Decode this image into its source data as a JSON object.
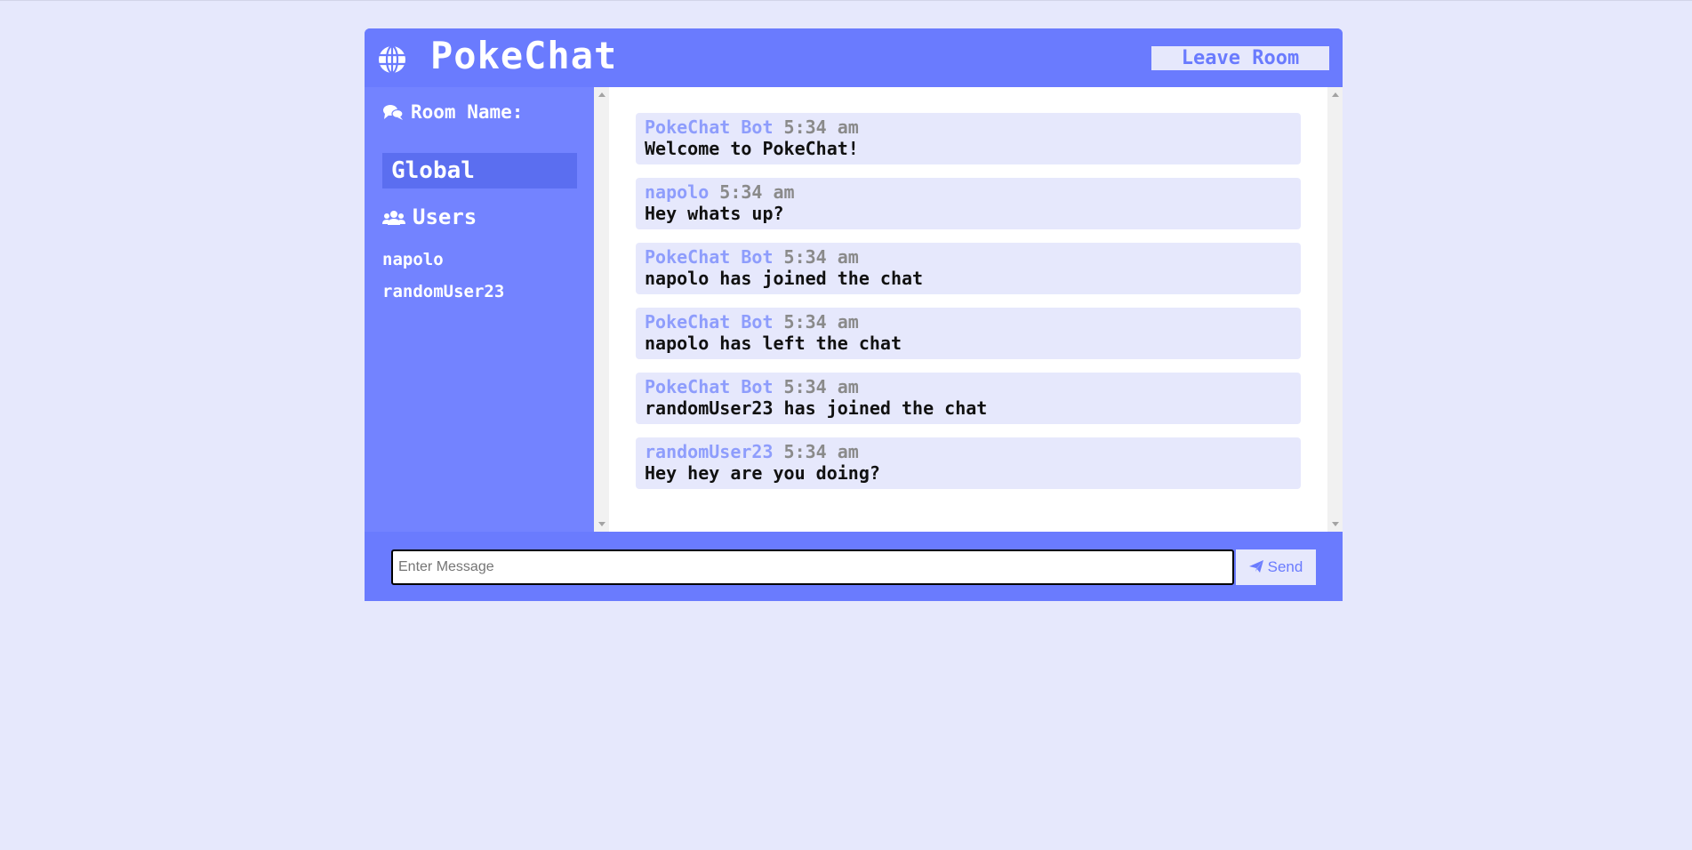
{
  "header": {
    "title": "PokeChat",
    "leave_label": "Leave Room",
    "logo_icon": "globe-icon"
  },
  "sidebar": {
    "room_heading": "Room Name:",
    "room_icon": "comments-icon",
    "room_name": "Global",
    "users_heading": "Users",
    "users_icon": "users-icon",
    "users": [
      "napolo",
      "randomUser23"
    ]
  },
  "messages": [
    {
      "user": "PokeChat Bot",
      "time": "5:34 am",
      "text": "Welcome to PokeChat!"
    },
    {
      "user": "napolo",
      "time": "5:34 am",
      "text": "Hey whats up?"
    },
    {
      "user": "PokeChat Bot",
      "time": "5:34 am",
      "text": "napolo has joined the chat"
    },
    {
      "user": "PokeChat Bot",
      "time": "5:34 am",
      "text": "napolo has left the chat"
    },
    {
      "user": "PokeChat Bot",
      "time": "5:34 am",
      "text": "randomUser23 has joined the chat"
    },
    {
      "user": "randomUser23",
      "time": "5:34 am",
      "text": "Hey hey are you doing?"
    }
  ],
  "form": {
    "input_value": "",
    "input_placeholder": "Enter Message",
    "send_label": "Send",
    "send_icon": "paper-plane-icon"
  },
  "colors": {
    "primary": "#6a7bfe",
    "sidebar": "#7383ff",
    "light": "#e6e8fc",
    "username": "#8e9dfc",
    "timestamp": "#8a8a8a"
  }
}
